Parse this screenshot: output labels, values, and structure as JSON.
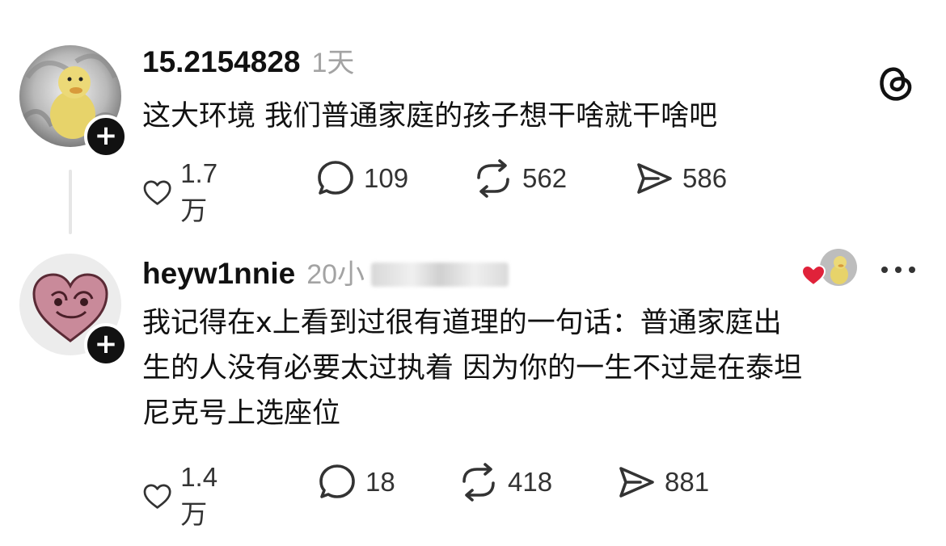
{
  "posts": [
    {
      "username": "15.2154828",
      "time": "1天",
      "text": "这大环境 我们普通家庭的孩子想干啥就干啥吧",
      "likes": "1.7万",
      "comments": "109",
      "reposts": "562",
      "shares": "586"
    },
    {
      "username": "heyw1nnie",
      "time": "20小",
      "text_lines": [
        "我记得在x上看到过很有道理的一句话：普通家庭出",
        "生的人没有必要太过执着 因为你的一生不过是在泰坦",
        "尼克号上选座位"
      ],
      "likes": "1.4万",
      "comments": "18",
      "reposts": "418",
      "shares": "881"
    }
  ],
  "icons": {
    "follow": "plus-icon",
    "like": "heart-icon",
    "comment": "comment-icon",
    "repost": "repost-icon",
    "share": "send-icon",
    "brand": "threads-logo-icon",
    "more": "more-icon"
  },
  "follow_symbol": "+",
  "colors": {
    "text": "#111111",
    "muted": "#a3a3a3",
    "icon": "#333333",
    "liked_heart": "#e0223a"
  }
}
